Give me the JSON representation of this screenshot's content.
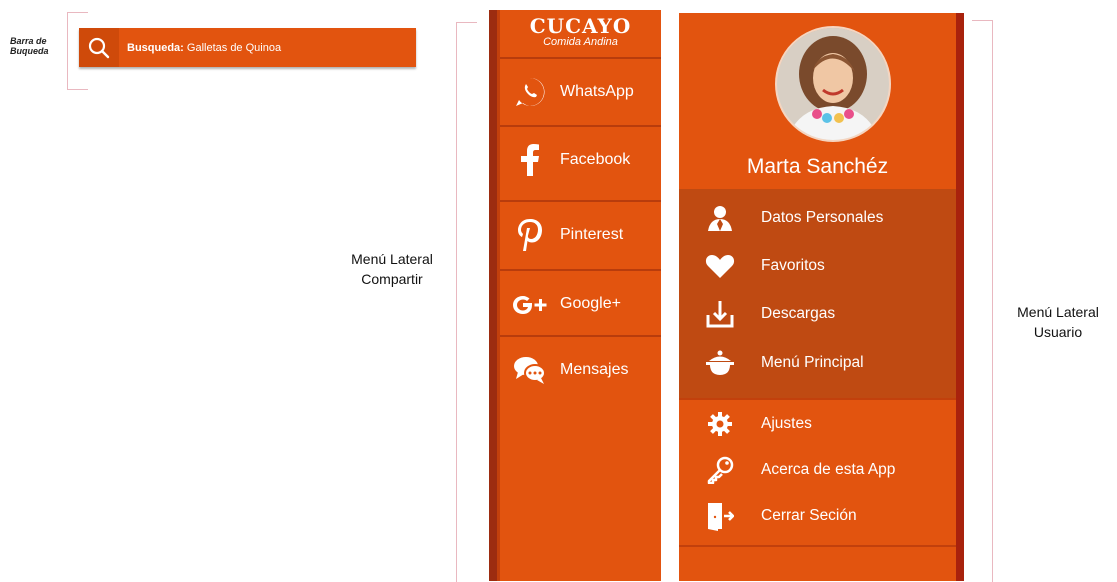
{
  "search_annotation": {
    "caption_line1": "Barra de",
    "caption_line2": "Buqueda",
    "label": "Busqueda:",
    "value": "Galletas de Quinoa"
  },
  "share_caption": {
    "line1": "Menú Lateral",
    "line2": "Compartir"
  },
  "user_caption": {
    "line1": "Menú Lateral",
    "line2": "Usuario"
  },
  "share_menu": {
    "logo_title": "CUCAYO",
    "logo_subtitle": "Comida Andina",
    "items": [
      {
        "label": "WhatsApp",
        "icon": "whatsapp-icon"
      },
      {
        "label": "Facebook",
        "icon": "facebook-icon"
      },
      {
        "label": "Pinterest",
        "icon": "pinterest-icon"
      },
      {
        "label": "Google+",
        "icon": "google-plus-icon"
      },
      {
        "label": "Mensajes",
        "icon": "chat-bubbles-icon"
      }
    ]
  },
  "user_menu": {
    "user_name": "Marta Sanchéz",
    "primary_items": [
      {
        "label": "Datos Personales",
        "icon": "person-icon"
      },
      {
        "label": "Favoritos",
        "icon": "heart-icon"
      },
      {
        "label": "Descargas",
        "icon": "download-icon"
      },
      {
        "label": "Menú Principal",
        "icon": "cooking-pot-icon"
      }
    ],
    "secondary_items": [
      {
        "label": "Ajustes",
        "icon": "gear-icon"
      },
      {
        "label": "Acerca de esta App",
        "icon": "key-icon"
      },
      {
        "label": "Cerrar Seción",
        "icon": "exit-door-icon"
      }
    ]
  },
  "colors": {
    "primary": "#e2540f",
    "dark": "#bf4a12",
    "edge": "#9c2c10"
  }
}
